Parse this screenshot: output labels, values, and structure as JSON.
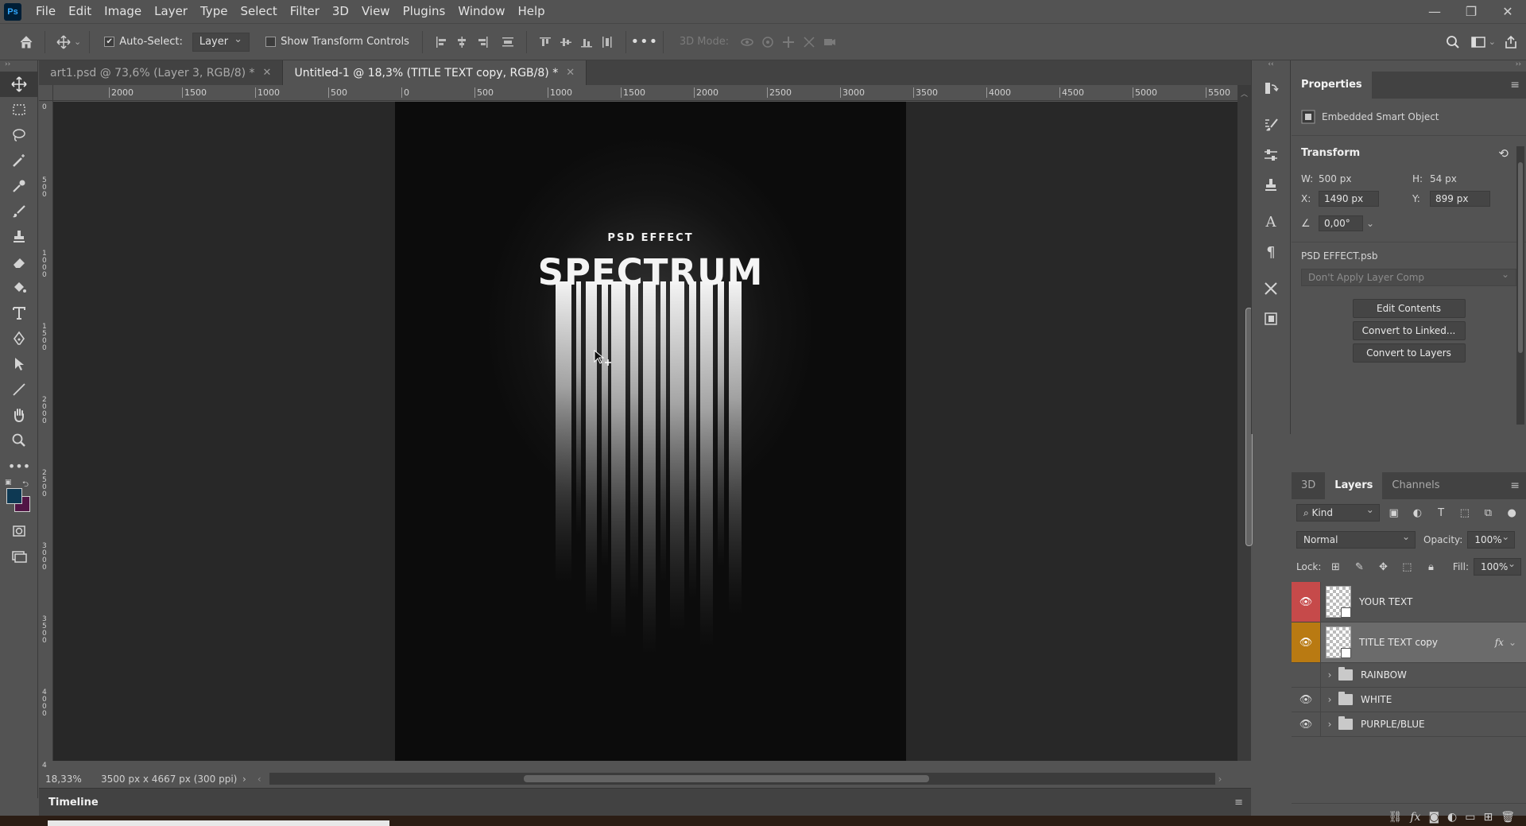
{
  "app": {
    "logo": "Ps",
    "menu": [
      "File",
      "Edit",
      "Image",
      "Layer",
      "Type",
      "Select",
      "Filter",
      "3D",
      "View",
      "Plugins",
      "Window",
      "Help"
    ]
  },
  "options": {
    "auto_select_label": "Auto-Select:",
    "auto_select_value": "Layer",
    "show_transform_label": "Show Transform Controls",
    "three_d_mode": "3D Mode:"
  },
  "tabs": [
    {
      "label": "art1.psd @ 73,6% (Layer 3, RGB/8) *",
      "active": false
    },
    {
      "label": "Untitled-1 @ 18,3% (TITLE TEXT copy, RGB/8) *",
      "active": true
    }
  ],
  "ruler": {
    "top": [
      "2000",
      "1500",
      "1000",
      "500",
      "0",
      "500",
      "1000",
      "1500",
      "2000",
      "2500",
      "3000",
      "3500",
      "4000",
      "4500",
      "5000",
      "5500"
    ],
    "left": [
      "0",
      "5\n0\n0",
      "1\n0\n0\n0",
      "1\n5\n0\n0",
      "2\n0\n0\n0",
      "2\n5\n0\n0",
      "3\n0\n0\n0",
      "3\n5\n0\n0",
      "4\n0\n0\n0",
      "4"
    ]
  },
  "document": {
    "subtitle": "PSD EFFECT",
    "title": "SPECTRUM"
  },
  "status": {
    "zoom": "18,33%",
    "doc_info": "3500 px x 4667 px (300 ppi)"
  },
  "timeline": {
    "label": "Timeline"
  },
  "properties": {
    "tab": "Properties",
    "object_type": "Embedded Smart Object",
    "transform_label": "Transform",
    "w_label": "W:",
    "w_value": "500 px",
    "h_label": "H:",
    "h_value": "54 px",
    "x_label": "X:",
    "x_value": "1490 px",
    "y_label": "Y:",
    "y_value": "899 px",
    "angle_value": "0,00°",
    "file_name": "PSD EFFECT.psb",
    "layer_comp": "Don't Apply Layer Comp",
    "buttons": [
      "Edit Contents",
      "Convert to Linked...",
      "Convert to Layers"
    ]
  },
  "layers_panel": {
    "tabs": [
      "3D",
      "Layers",
      "Channels"
    ],
    "active_tab": "Layers",
    "filter_kind": "Kind",
    "blend_mode": "Normal",
    "opacity_label": "Opacity:",
    "opacity_value": "100%",
    "lock_label": "Lock:",
    "fill_label": "Fill:",
    "fill_value": "100%",
    "layers": [
      {
        "name": "YOUR TEXT",
        "type": "smart",
        "visible": true,
        "eye_color": "#c64a4a",
        "selected": false
      },
      {
        "name": "TITLE TEXT copy",
        "type": "smart",
        "visible": true,
        "eye_color": "#b97a12",
        "selected": true,
        "fx": "fx"
      },
      {
        "name": "RAINBOW",
        "type": "group",
        "visible": false
      },
      {
        "name": "WHITE",
        "type": "group",
        "visible": true
      },
      {
        "name": "PURPLE/BLUE",
        "type": "group",
        "visible": true
      }
    ]
  },
  "colors": {
    "foreground": "#0e3953",
    "background": "#511545"
  }
}
